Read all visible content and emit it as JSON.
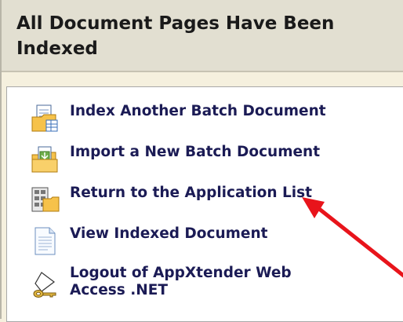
{
  "header": {
    "title": "All Document Pages Have Been Indexed"
  },
  "menu": {
    "items": [
      {
        "label": "Index Another Batch Document",
        "icon": "batch-document-icon"
      },
      {
        "label": "Import a New Batch Document",
        "icon": "import-folder-icon"
      },
      {
        "label": "Return to the Application List",
        "icon": "application-list-icon"
      },
      {
        "label": "View Indexed Document",
        "icon": "document-icon"
      },
      {
        "label": "Logout of AppXtender Web\nAccess .NET",
        "icon": "key-logout-icon"
      }
    ]
  },
  "annotation": {
    "arrow_color": "#e8141b",
    "arrow": "red-arrow-pointing-to-return-to-application-list"
  }
}
